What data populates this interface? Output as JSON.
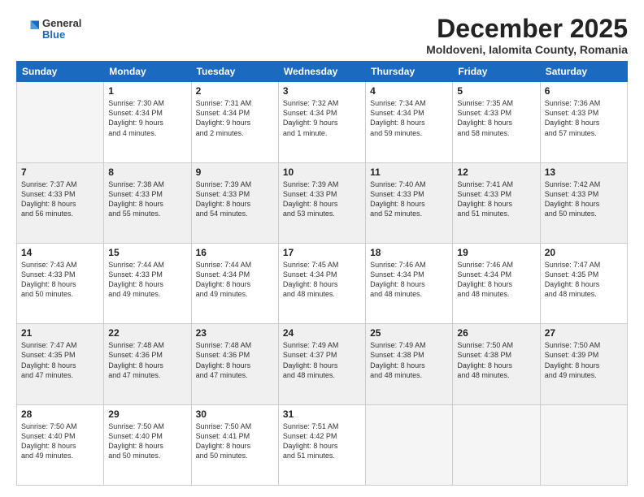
{
  "logo": {
    "general": "General",
    "blue": "Blue"
  },
  "header": {
    "title": "December 2025",
    "subtitle": "Moldoveni, Ialomita County, Romania"
  },
  "weekdays": [
    "Sunday",
    "Monday",
    "Tuesday",
    "Wednesday",
    "Thursday",
    "Friday",
    "Saturday"
  ],
  "weeks": [
    [
      {
        "day": "",
        "text": ""
      },
      {
        "day": "1",
        "text": "Sunrise: 7:30 AM\nSunset: 4:34 PM\nDaylight: 9 hours\nand 4 minutes."
      },
      {
        "day": "2",
        "text": "Sunrise: 7:31 AM\nSunset: 4:34 PM\nDaylight: 9 hours\nand 2 minutes."
      },
      {
        "day": "3",
        "text": "Sunrise: 7:32 AM\nSunset: 4:34 PM\nDaylight: 9 hours\nand 1 minute."
      },
      {
        "day": "4",
        "text": "Sunrise: 7:34 AM\nSunset: 4:34 PM\nDaylight: 8 hours\nand 59 minutes."
      },
      {
        "day": "5",
        "text": "Sunrise: 7:35 AM\nSunset: 4:33 PM\nDaylight: 8 hours\nand 58 minutes."
      },
      {
        "day": "6",
        "text": "Sunrise: 7:36 AM\nSunset: 4:33 PM\nDaylight: 8 hours\nand 57 minutes."
      }
    ],
    [
      {
        "day": "7",
        "text": "Sunrise: 7:37 AM\nSunset: 4:33 PM\nDaylight: 8 hours\nand 56 minutes."
      },
      {
        "day": "8",
        "text": "Sunrise: 7:38 AM\nSunset: 4:33 PM\nDaylight: 8 hours\nand 55 minutes."
      },
      {
        "day": "9",
        "text": "Sunrise: 7:39 AM\nSunset: 4:33 PM\nDaylight: 8 hours\nand 54 minutes."
      },
      {
        "day": "10",
        "text": "Sunrise: 7:39 AM\nSunset: 4:33 PM\nDaylight: 8 hours\nand 53 minutes."
      },
      {
        "day": "11",
        "text": "Sunrise: 7:40 AM\nSunset: 4:33 PM\nDaylight: 8 hours\nand 52 minutes."
      },
      {
        "day": "12",
        "text": "Sunrise: 7:41 AM\nSunset: 4:33 PM\nDaylight: 8 hours\nand 51 minutes."
      },
      {
        "day": "13",
        "text": "Sunrise: 7:42 AM\nSunset: 4:33 PM\nDaylight: 8 hours\nand 50 minutes."
      }
    ],
    [
      {
        "day": "14",
        "text": "Sunrise: 7:43 AM\nSunset: 4:33 PM\nDaylight: 8 hours\nand 50 minutes."
      },
      {
        "day": "15",
        "text": "Sunrise: 7:44 AM\nSunset: 4:33 PM\nDaylight: 8 hours\nand 49 minutes."
      },
      {
        "day": "16",
        "text": "Sunrise: 7:44 AM\nSunset: 4:34 PM\nDaylight: 8 hours\nand 49 minutes."
      },
      {
        "day": "17",
        "text": "Sunrise: 7:45 AM\nSunset: 4:34 PM\nDaylight: 8 hours\nand 48 minutes."
      },
      {
        "day": "18",
        "text": "Sunrise: 7:46 AM\nSunset: 4:34 PM\nDaylight: 8 hours\nand 48 minutes."
      },
      {
        "day": "19",
        "text": "Sunrise: 7:46 AM\nSunset: 4:34 PM\nDaylight: 8 hours\nand 48 minutes."
      },
      {
        "day": "20",
        "text": "Sunrise: 7:47 AM\nSunset: 4:35 PM\nDaylight: 8 hours\nand 48 minutes."
      }
    ],
    [
      {
        "day": "21",
        "text": "Sunrise: 7:47 AM\nSunset: 4:35 PM\nDaylight: 8 hours\nand 47 minutes."
      },
      {
        "day": "22",
        "text": "Sunrise: 7:48 AM\nSunset: 4:36 PM\nDaylight: 8 hours\nand 47 minutes."
      },
      {
        "day": "23",
        "text": "Sunrise: 7:48 AM\nSunset: 4:36 PM\nDaylight: 8 hours\nand 47 minutes."
      },
      {
        "day": "24",
        "text": "Sunrise: 7:49 AM\nSunset: 4:37 PM\nDaylight: 8 hours\nand 48 minutes."
      },
      {
        "day": "25",
        "text": "Sunrise: 7:49 AM\nSunset: 4:38 PM\nDaylight: 8 hours\nand 48 minutes."
      },
      {
        "day": "26",
        "text": "Sunrise: 7:50 AM\nSunset: 4:38 PM\nDaylight: 8 hours\nand 48 minutes."
      },
      {
        "day": "27",
        "text": "Sunrise: 7:50 AM\nSunset: 4:39 PM\nDaylight: 8 hours\nand 49 minutes."
      }
    ],
    [
      {
        "day": "28",
        "text": "Sunrise: 7:50 AM\nSunset: 4:40 PM\nDaylight: 8 hours\nand 49 minutes."
      },
      {
        "day": "29",
        "text": "Sunrise: 7:50 AM\nSunset: 4:40 PM\nDaylight: 8 hours\nand 50 minutes."
      },
      {
        "day": "30",
        "text": "Sunrise: 7:50 AM\nSunset: 4:41 PM\nDaylight: 8 hours\nand 50 minutes."
      },
      {
        "day": "31",
        "text": "Sunrise: 7:51 AM\nSunset: 4:42 PM\nDaylight: 8 hours\nand 51 minutes."
      },
      {
        "day": "",
        "text": ""
      },
      {
        "day": "",
        "text": ""
      },
      {
        "day": "",
        "text": ""
      }
    ]
  ]
}
